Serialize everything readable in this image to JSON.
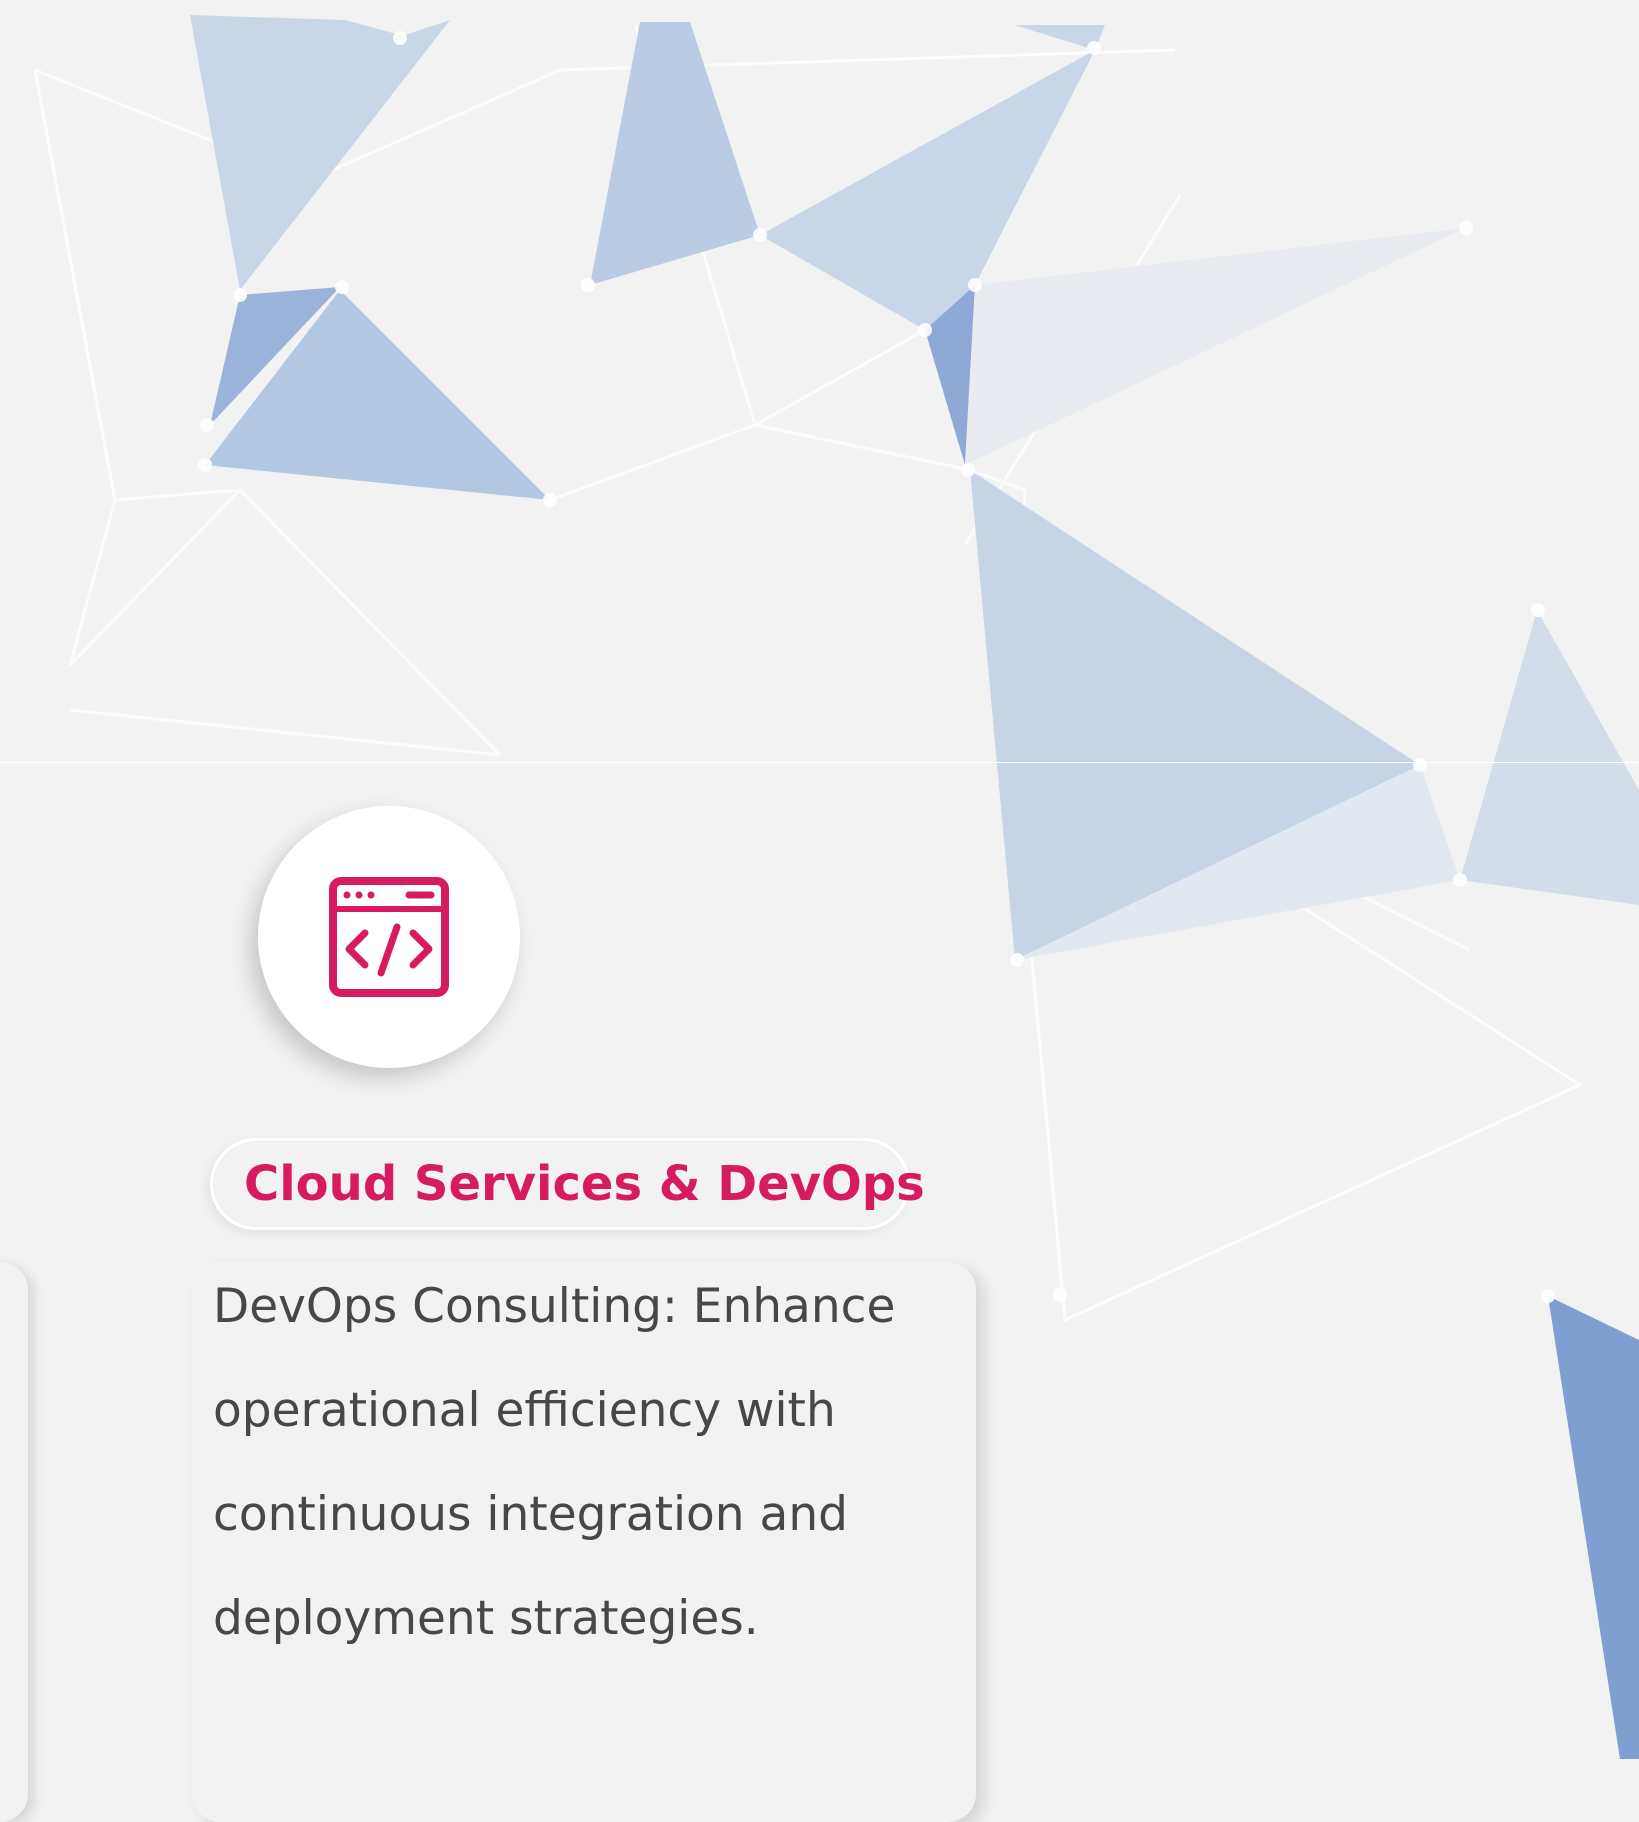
{
  "service": {
    "title": "Cloud Services & DevOps",
    "description": "DevOps Consulting: Enhance operational efficiency with continuous integration and deployment strategies.",
    "icon": "code-window-icon"
  },
  "colors": {
    "accent": "#d71b60",
    "background": "#f2f2f2",
    "body_text": "#474747",
    "polygon_blue": "#7f9fd1"
  }
}
